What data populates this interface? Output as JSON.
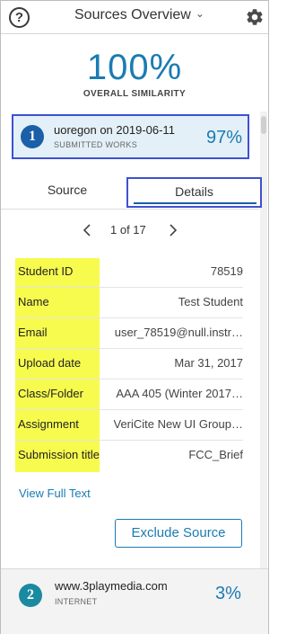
{
  "header": {
    "help_icon": "question-circle-icon",
    "title": "Sources Overview",
    "dropdown_icon": "chevron-down-icon",
    "settings_icon": "gear-icon"
  },
  "similarity": {
    "percent": "100%",
    "label": "OVERALL SIMILARITY"
  },
  "sources": [
    {
      "number": "1",
      "title": "uoregon on 2019-06-11",
      "type": "SUBMITTED WORKS",
      "percent": "97%",
      "color": "#1a5fa8"
    },
    {
      "number": "2",
      "title": "www.3playmedia.com",
      "type": "INTERNET",
      "percent": "3%",
      "color": "#1a8aa0"
    }
  ],
  "tabs": [
    {
      "label": "Source",
      "active": false
    },
    {
      "label": "Details",
      "active": true
    }
  ],
  "pager": {
    "text": "1 of 17",
    "prev_icon": "chevron-left-icon",
    "next_icon": "chevron-right-icon"
  },
  "details": [
    {
      "label": "Student ID",
      "value": "78519"
    },
    {
      "label": "Name",
      "value": "Test Student"
    },
    {
      "label": "Email",
      "value": "user_78519@null.instr…"
    },
    {
      "label": "Upload date",
      "value": "Mar 31, 2017"
    },
    {
      "label": "Class/Folder",
      "value": "AAA 405 (Winter 2017…"
    },
    {
      "label": "Assignment",
      "value": "VeriCite New UI Group…"
    },
    {
      "label": "Submission title",
      "value": "FCC_Brief"
    }
  ],
  "actions": {
    "view_full_text": "View Full Text",
    "exclude_source": "Exclude Source"
  },
  "colors": {
    "accent": "#1a7bb3",
    "highlight": "#f7fb4e",
    "selection_border": "#3d51d3"
  }
}
